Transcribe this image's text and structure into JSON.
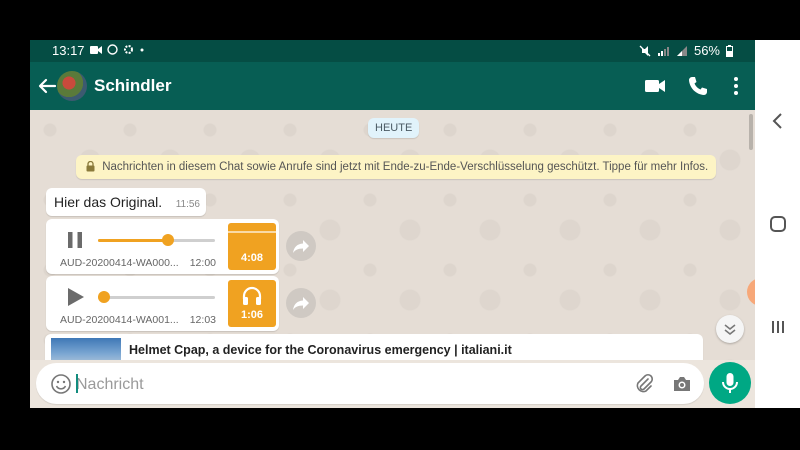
{
  "status_bar": {
    "time": "13:17",
    "battery": "56%"
  },
  "app_bar": {
    "contact_name": "Schindler"
  },
  "chat": {
    "date_label": "HEUTE",
    "encryption_notice": "Nachrichten in diesem Chat sowie Anrufe sind jetzt mit Ende-zu-Ende-Verschlüsselung geschützt. Tippe für mehr Infos.",
    "messages": [
      {
        "type": "text",
        "text": "Hier das Original.",
        "time": "11:56"
      }
    ],
    "audio_messages": [
      {
        "filename": "AUD-20200414-WA000...",
        "time": "12:00",
        "duration": "4:08",
        "state": "pause-icon",
        "progress": 0.6
      },
      {
        "filename": "AUD-20200414-WA001...",
        "time": "12:03",
        "duration": "1:06",
        "state": "play-icon",
        "progress": 0.05
      }
    ],
    "link_preview": {
      "title": "Helmet Cpap, a device for the Coronavirus emergency | italiani.it"
    }
  },
  "input": {
    "placeholder": "Nachricht"
  },
  "colors": {
    "header": "#075e54",
    "status": "#054d44",
    "accent": "#00a884",
    "audio": "#f0a221",
    "note": "#fdf4c5"
  }
}
